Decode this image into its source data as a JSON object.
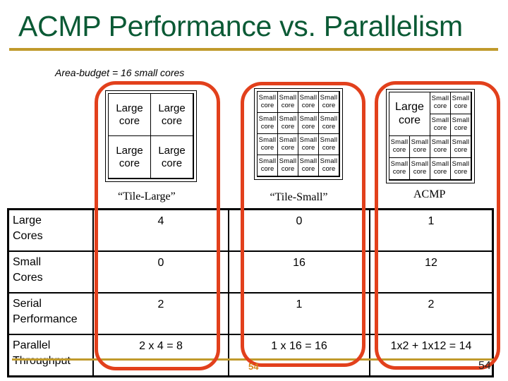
{
  "slide": {
    "title": "ACMP Performance vs. Parallelism",
    "subtitle": "Area-budget = 16 small cores",
    "page_number_left": "54",
    "page_number_right": "54",
    "accent_colors": {
      "title": "#0b5a35",
      "rule": "#c09a2c",
      "highlight": "#e2401c"
    }
  },
  "configs": {
    "tile_large": {
      "label": "“Tile-Large”",
      "cells": [
        {
          "line1": "Large",
          "line2": "core"
        },
        {
          "line1": "Large",
          "line2": "core"
        },
        {
          "line1": "Large",
          "line2": "core"
        },
        {
          "line1": "Large",
          "line2": "core"
        }
      ]
    },
    "tile_small": {
      "label": "“Tile-Small”",
      "cell_line1": "Small",
      "cell_line2": "core",
      "count": 16
    },
    "acmp": {
      "label": "ACMP",
      "large": {
        "line1": "Large",
        "line2": "core"
      },
      "cell_line1": "Small",
      "cell_line2": "core",
      "small_count": 12
    }
  },
  "table": {
    "rows": [
      {
        "label": "Large Cores",
        "label_l1": "Large",
        "label_l2": "Cores",
        "tile_large": "4",
        "tile_small": "0",
        "acmp": "1"
      },
      {
        "label": "Small Cores",
        "label_l1": "Small",
        "label_l2": "Cores",
        "tile_large": "0",
        "tile_small": "16",
        "acmp": "12"
      },
      {
        "label": "Serial Performance",
        "label_l1": "Serial",
        "label_l2": "Performance",
        "tile_large": "2",
        "tile_small": "1",
        "acmp": "2"
      },
      {
        "label": "Parallel Throughput",
        "label_l1": "Parallel",
        "label_l2": "Throughput",
        "tile_large": "2 x 4 = 8",
        "tile_small": "1 x 16 = 16",
        "acmp": "1x2 + 1x12 = 14"
      }
    ]
  }
}
